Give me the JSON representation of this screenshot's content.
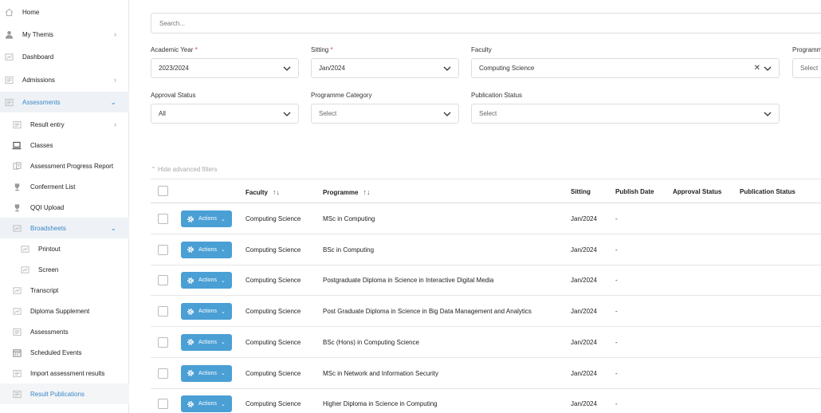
{
  "sidebar": {
    "items": [
      {
        "label": "Home",
        "icon": "home-icon"
      },
      {
        "label": "My Themis",
        "icon": "user-icon"
      },
      {
        "label": "Dashboard",
        "icon": "dashboard-icon"
      },
      {
        "label": "Admissions",
        "icon": "admissions-icon"
      },
      {
        "label": "Assessments",
        "icon": "assessments-icon"
      },
      {
        "label": "Result entry",
        "icon": "result-entry-icon"
      },
      {
        "label": "Classes",
        "icon": "laptop-icon"
      },
      {
        "label": "Assessment Progress Report",
        "icon": "report-icon"
      },
      {
        "label": "Conferment List",
        "icon": "trophy-icon"
      },
      {
        "label": "QQI Upload",
        "icon": "trophy-icon"
      },
      {
        "label": "Broadsheets",
        "icon": "broadsheets-icon"
      },
      {
        "label": "Printout",
        "icon": "printout-icon"
      },
      {
        "label": "Screen",
        "icon": "screen-icon"
      },
      {
        "label": "Transcript",
        "icon": "transcript-icon"
      },
      {
        "label": "Diploma Supplement",
        "icon": "diploma-icon"
      },
      {
        "label": "Assessments",
        "icon": "assessments-icon"
      },
      {
        "label": "Scheduled Events",
        "icon": "calendar-icon"
      },
      {
        "label": "Import assessment results",
        "icon": "import-icon"
      },
      {
        "label": "Result Publications",
        "icon": "publications-icon"
      }
    ]
  },
  "search": {
    "placeholder": "Search..."
  },
  "filters": {
    "academic_year": {
      "label": "Academic Year",
      "required": "*",
      "value": "2023/2024"
    },
    "sitting": {
      "label": "Sitting",
      "required": "*",
      "value": "Jan/2024"
    },
    "faculty": {
      "label": "Faculty",
      "value": "Computing Science"
    },
    "programme": {
      "label": "Programm",
      "value": "Select"
    },
    "approval_status": {
      "label": "Approval Status",
      "value": "All"
    },
    "programme_category": {
      "label": "Programme Category",
      "value": "Select"
    },
    "publication_status": {
      "label": "Publication Status",
      "value": "Select"
    }
  },
  "advanced_toggle": "Hide advanced filters",
  "table": {
    "headers": {
      "faculty": "Faculty",
      "programme": "Programme",
      "sitting": "Sitting",
      "publish_date": "Publish Date",
      "approval_status": "Approval Status",
      "publication_status": "Publication Status"
    },
    "action_label": "Actions",
    "rows": [
      {
        "faculty": "Computing Science",
        "programme": "MSc in Computing",
        "sitting": "Jan/2024",
        "publish_date": "-"
      },
      {
        "faculty": "Computing Science",
        "programme": "BSc in Computing",
        "sitting": "Jan/2024",
        "publish_date": "-"
      },
      {
        "faculty": "Computing Science",
        "programme": "Postgraduate Diploma in Science in Interactive Digital Media",
        "sitting": "Jan/2024",
        "publish_date": "-"
      },
      {
        "faculty": "Computing Science",
        "programme": "Post Graduate Diploma in Science in Big Data Management and Analytics",
        "sitting": "Jan/2024",
        "publish_date": "-"
      },
      {
        "faculty": "Computing Science",
        "programme": "BSc (Hons) in Computing Science",
        "sitting": "Jan/2024",
        "publish_date": "-"
      },
      {
        "faculty": "Computing Science",
        "programme": "MSc in Network and Information Security",
        "sitting": "Jan/2024",
        "publish_date": "-"
      },
      {
        "faculty": "Computing Science",
        "programme": "Higher Diploma in Science in Computing",
        "sitting": "Jan/2024",
        "publish_date": "-"
      }
    ]
  },
  "colors": {
    "accent": "#3a86c7",
    "button": "#4a9fd5"
  }
}
